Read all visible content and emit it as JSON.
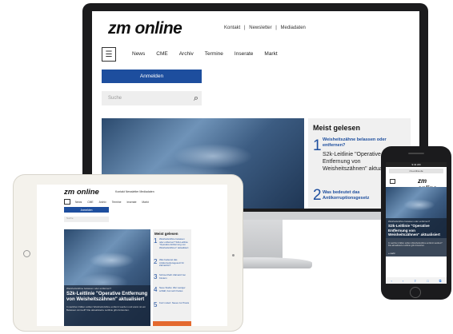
{
  "desktop": {
    "logo": "zm online",
    "top_links": [
      "Kontakt",
      "|",
      "Newsletter",
      "|",
      "Mediadaten"
    ],
    "nav": [
      "News",
      "CME",
      "Archiv",
      "Termine",
      "Inserate",
      "Markt"
    ],
    "login_label": "Anmelden",
    "search_placeholder": "Suche",
    "popular": {
      "heading": "Meist gelesen",
      "item1_number": "1",
      "item1_title": "Weisheitszähne belassen oder entfernen?",
      "item1_subtitle": "S2k-Leitlinie \"Operative Entfernung von Weisheitszähnen\" aktualisiert",
      "item2_number": "2",
      "item2_title": "Was bedeutet das Antikorruptionsgesetz"
    }
  },
  "tablet": {
    "logo": "zm online",
    "top_links": "Kontakt   Newsletter   Mediadaten",
    "nav": [
      "News",
      "CME",
      "Archiv",
      "Termine",
      "Inserate",
      "Markt"
    ],
    "login_label": "Anmelden",
    "search_placeholder": "Suche",
    "kicker": "Weisheitszähne belassen oder entfernen?",
    "headline": "S2k-Leitlinie \"Operative Entfernung von Weisheitszähnen\" aktualisiert",
    "teaser": "In welchen Fällen sollten Weisheitszähne entfernt werden und wann ist ein Belassen sinnvoll? Die aktualisierte Leitlinie gibt Antworten.",
    "popular_heading": "Meist gelesen",
    "popular_items": [
      {
        "n": "1",
        "text": "Weisheitszähne belassen oder entfernen? S2k-Leitlinie \"Operative Entfernung von Weisheitszähnen\" aktualisiert"
      },
      {
        "n": "2",
        "text": "Was bedeutet das Antikorruptionsgesetz für Zahnärzte?"
      },
      {
        "n": "3",
        "text": "Schmerzhaft: Zahnarzt bei Kindern"
      },
      {
        "n": "4",
        "text": "Neue Studie: Wer weniger schläft, hat mehr Karies"
      },
      {
        "n": "5",
        "text": "Kurz notiert: Neues zur Praxis"
      }
    ]
  },
  "phone": {
    "status": "9:41 AM",
    "url": "zm-online.de",
    "logo": "zm online",
    "kicker": "Weisheitszähne belassen oder entfernen?",
    "headline": "S2k-Leitlinie \"Operative Entfernung von Weisheitszähnen\" aktualisiert",
    "teaser": "In welchen Fällen sollten Weisheitszähne entfernt werden? Die aktualisierte Leitlinie gibt Antworten.",
    "more": "» mehr",
    "toolbar": [
      "‹",
      "›",
      "⇪",
      "□",
      "⧉"
    ]
  }
}
